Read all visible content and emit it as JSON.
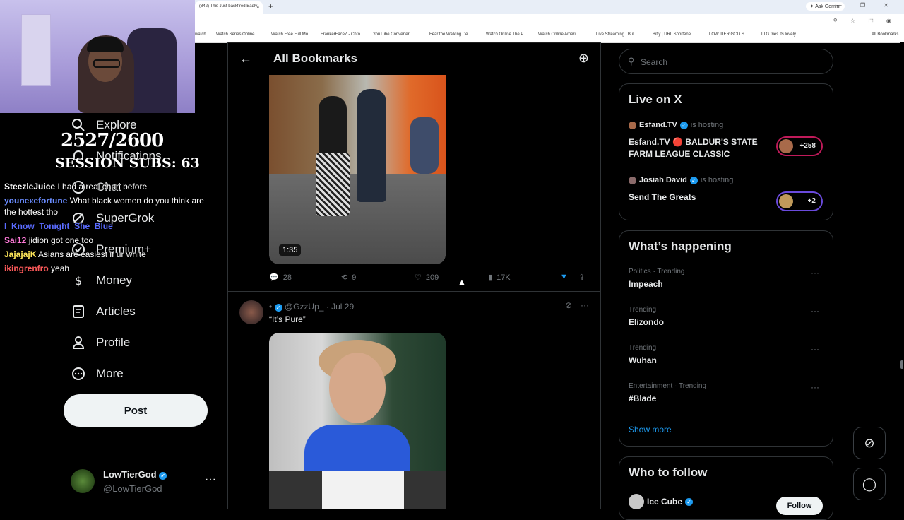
{
  "browser": {
    "tab_title": "(842) This Just backfired Badly",
    "tab_close": "×",
    "new_tab": "+",
    "gemini": "✦ Ask Gemini",
    "window_controls": "— ❐ ✕",
    "bookmarks": [
      "watch",
      "Watch Series Online...",
      "Watch Free Full Mo...",
      "FrankerFaceZ - Chro...",
      "YouTube Converter...",
      "Fear the Walking De...",
      "Watch Online The P...",
      "Watch Online Ameri...",
      "Live Streaming | Bul...",
      "Bitly | URL Shortene...",
      "LOW TIER GOD S...",
      "LTG tries its lovely...",
      "All Bookmarks"
    ]
  },
  "overlay": {
    "counter": "2527/2600",
    "subs": "SESSION SUBS: 63"
  },
  "chat": [
    {
      "user": "SteezleJuice",
      "msg": "I had a real chun before",
      "color": "#ffffff"
    },
    {
      "user": "youneкefortune",
      "msg": "What black women do you think are the hottest tho",
      "color": "#6a8cff"
    },
    {
      "user": "I_Know_Tonight_She_Blue",
      "msg": "",
      "color": "#5a6bff"
    },
    {
      "user": "Sai12",
      "msg": "jidion got one too",
      "color": "#ff7ad9"
    },
    {
      "user": "JajajajK",
      "msg": "Asians are easiest if ur white",
      "color": "#ffe75a"
    },
    {
      "user": "ikingrenfro",
      "msg": "yeah",
      "color": "#ff5a5a"
    }
  ],
  "nav": {
    "items": [
      {
        "label": "Explore",
        "icon": "search-icon"
      },
      {
        "label": "Notifications",
        "icon": "bell-icon"
      },
      {
        "label": "Chat",
        "icon": "chat-icon"
      },
      {
        "label": "SuperGrok",
        "icon": "grok-icon"
      },
      {
        "label": "Premium+",
        "icon": "premium-icon"
      },
      {
        "label": "Money",
        "icon": "money-icon"
      },
      {
        "label": "Articles",
        "icon": "articles-icon"
      },
      {
        "label": "Profile",
        "icon": "profile-icon"
      },
      {
        "label": "More",
        "icon": "more-icon"
      }
    ],
    "post_label": "Post"
  },
  "account": {
    "name": "LowTierGod",
    "handle": "@LowTierGod",
    "more": "···"
  },
  "main": {
    "title": "All Bookmarks",
    "tweet1": {
      "duration": "1:35",
      "replies": "28",
      "reposts": "9",
      "likes": "209",
      "views": "17K"
    },
    "tweet2": {
      "handle": "@GzzUp_",
      "date": "Jul 29",
      "text": "“It’s Pure”"
    }
  },
  "right": {
    "search_placeholder": "Search",
    "live": {
      "title": "Live on X",
      "items": [
        {
          "host": "Esfand.TV",
          "status": "is hosting",
          "title": "Esfand.TV 🔴 BALDUR'S STATE FARM LEAGUE CLASSIC",
          "count": "+258"
        },
        {
          "host": "Josiah David",
          "status": "is hosting",
          "title": "Send The Greats",
          "count": "+2"
        }
      ]
    },
    "happening": {
      "title": "What’s happening",
      "trends": [
        {
          "meta": "Politics · Trending",
          "name": "Impeach"
        },
        {
          "meta": "Trending",
          "name": "Elizondo"
        },
        {
          "meta": "Trending",
          "name": "Wuhan"
        },
        {
          "meta": "Entertainment · Trending",
          "name": "#Blade"
        }
      ],
      "show_more": "Show more"
    },
    "follow": {
      "title": "Who to follow",
      "name": "Ice Cube",
      "button": "Follow"
    }
  },
  "colors": {
    "accent": "#1d9bf0",
    "background": "#000000",
    "border": "#2f3336",
    "live_ring": "#c01a5a"
  }
}
